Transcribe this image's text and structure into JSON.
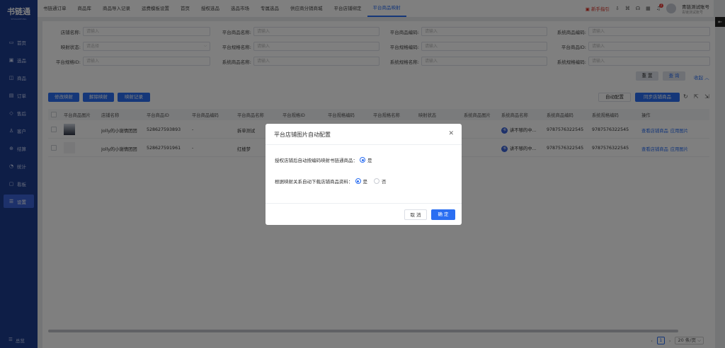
{
  "app": {
    "logo": "书链通",
    "logo_sub": "SHULIANTONG"
  },
  "sidebar": {
    "items": [
      {
        "label": "首页",
        "icon": "home-icon"
      },
      {
        "label": "选品",
        "icon": "select-icon"
      },
      {
        "label": "商品",
        "icon": "goods-icon"
      },
      {
        "label": "订单",
        "icon": "order-icon"
      },
      {
        "label": "售后",
        "icon": "aftersale-icon"
      },
      {
        "label": "客户",
        "icon": "customer-icon"
      },
      {
        "label": "结算",
        "icon": "settle-icon"
      },
      {
        "label": "统计",
        "icon": "stats-icon"
      },
      {
        "label": "看板",
        "icon": "board-icon"
      },
      {
        "label": "设置",
        "icon": "settings-icon"
      }
    ],
    "bottom": "总览"
  },
  "topbar": {
    "tabs": [
      "书链通订单",
      "商品库",
      "商品导入记录",
      "运费模板设置",
      "首页",
      "授权选品",
      "选品市场",
      "专属选品",
      "供应商分销商城",
      "平台店铺绑定",
      "平台商品映射"
    ],
    "guide": "新手指引",
    "badge": "2",
    "account": "青链测试账号",
    "account_sub": "青链测试账号"
  },
  "filters": {
    "row1": [
      {
        "label": "店铺名称:",
        "placeholder": "请输入"
      },
      {
        "label": "平台商品名称:",
        "placeholder": "请输入"
      },
      {
        "label": "平台商品编码:",
        "placeholder": "请输入"
      },
      {
        "label": "系统商品编码:",
        "placeholder": "请输入"
      }
    ],
    "row2": [
      {
        "label": "映射状态:",
        "placeholder": "请选择"
      },
      {
        "label": "平台规格名称:",
        "placeholder": "请输入"
      },
      {
        "label": "平台规格编码:",
        "placeholder": "请输入"
      },
      {
        "label": "平台商品ID:",
        "placeholder": "请输入"
      }
    ],
    "row3": [
      {
        "label": "平台规格ID:",
        "placeholder": "请输入"
      },
      {
        "label": "系统商品名称:",
        "placeholder": "请输入"
      },
      {
        "label": "系统规格名称:",
        "placeholder": "请输入"
      },
      {
        "label": "系统规格编码:",
        "placeholder": "请输入"
      }
    ],
    "reset": "重 置",
    "query": "查 询",
    "collapse": "收起"
  },
  "actions": {
    "modify": "修改映射",
    "unmap": "解除映射",
    "records": "映射记录",
    "auto_config": "自动配置",
    "sync": "同步店铺商品"
  },
  "table": {
    "headers": [
      "平台商品图片",
      "店铺名称",
      "平台商品ID",
      "平台商品编码",
      "平台商品名称",
      "平台规格ID",
      "平台规格编码",
      "平台规格名称",
      "映射状态",
      "系统商品图片",
      "系统商品名称",
      "系统商品编码",
      "系统规格编码",
      "操作"
    ],
    "rows": [
      {
        "shop": "Jolly的小谢情团团",
        "pid": "528627593893",
        "pcode": "-",
        "pname": "拆单测试",
        "sys_name": "讲不够的中...",
        "sys_code": "9787576322545",
        "sys_spec": "9787576322545",
        "ops": [
          "查看店铺商品",
          "应用图片"
        ]
      },
      {
        "shop": "Jolly的小谢情团团",
        "pid": "528627591961",
        "pcode": "-",
        "pname": "红楼梦",
        "sys_name": "讲不够的中...",
        "sys_code": "9787576322545",
        "sys_spec": "9787576322545",
        "ops": [
          "查看店铺商品",
          "应用图片"
        ]
      }
    ],
    "badge_text": "书"
  },
  "pager": {
    "current": "1",
    "size": "20 条/页"
  },
  "modal": {
    "title": "平台店铺图片自动配置",
    "q1": "授权店铺后自动按编码映射书链通商品：",
    "q1_yes": "是",
    "q2": "根据映射关系自动下载店铺商品资料：",
    "q2_yes": "是",
    "q2_no": "否",
    "cancel": "取 消",
    "ok": "确 定"
  }
}
